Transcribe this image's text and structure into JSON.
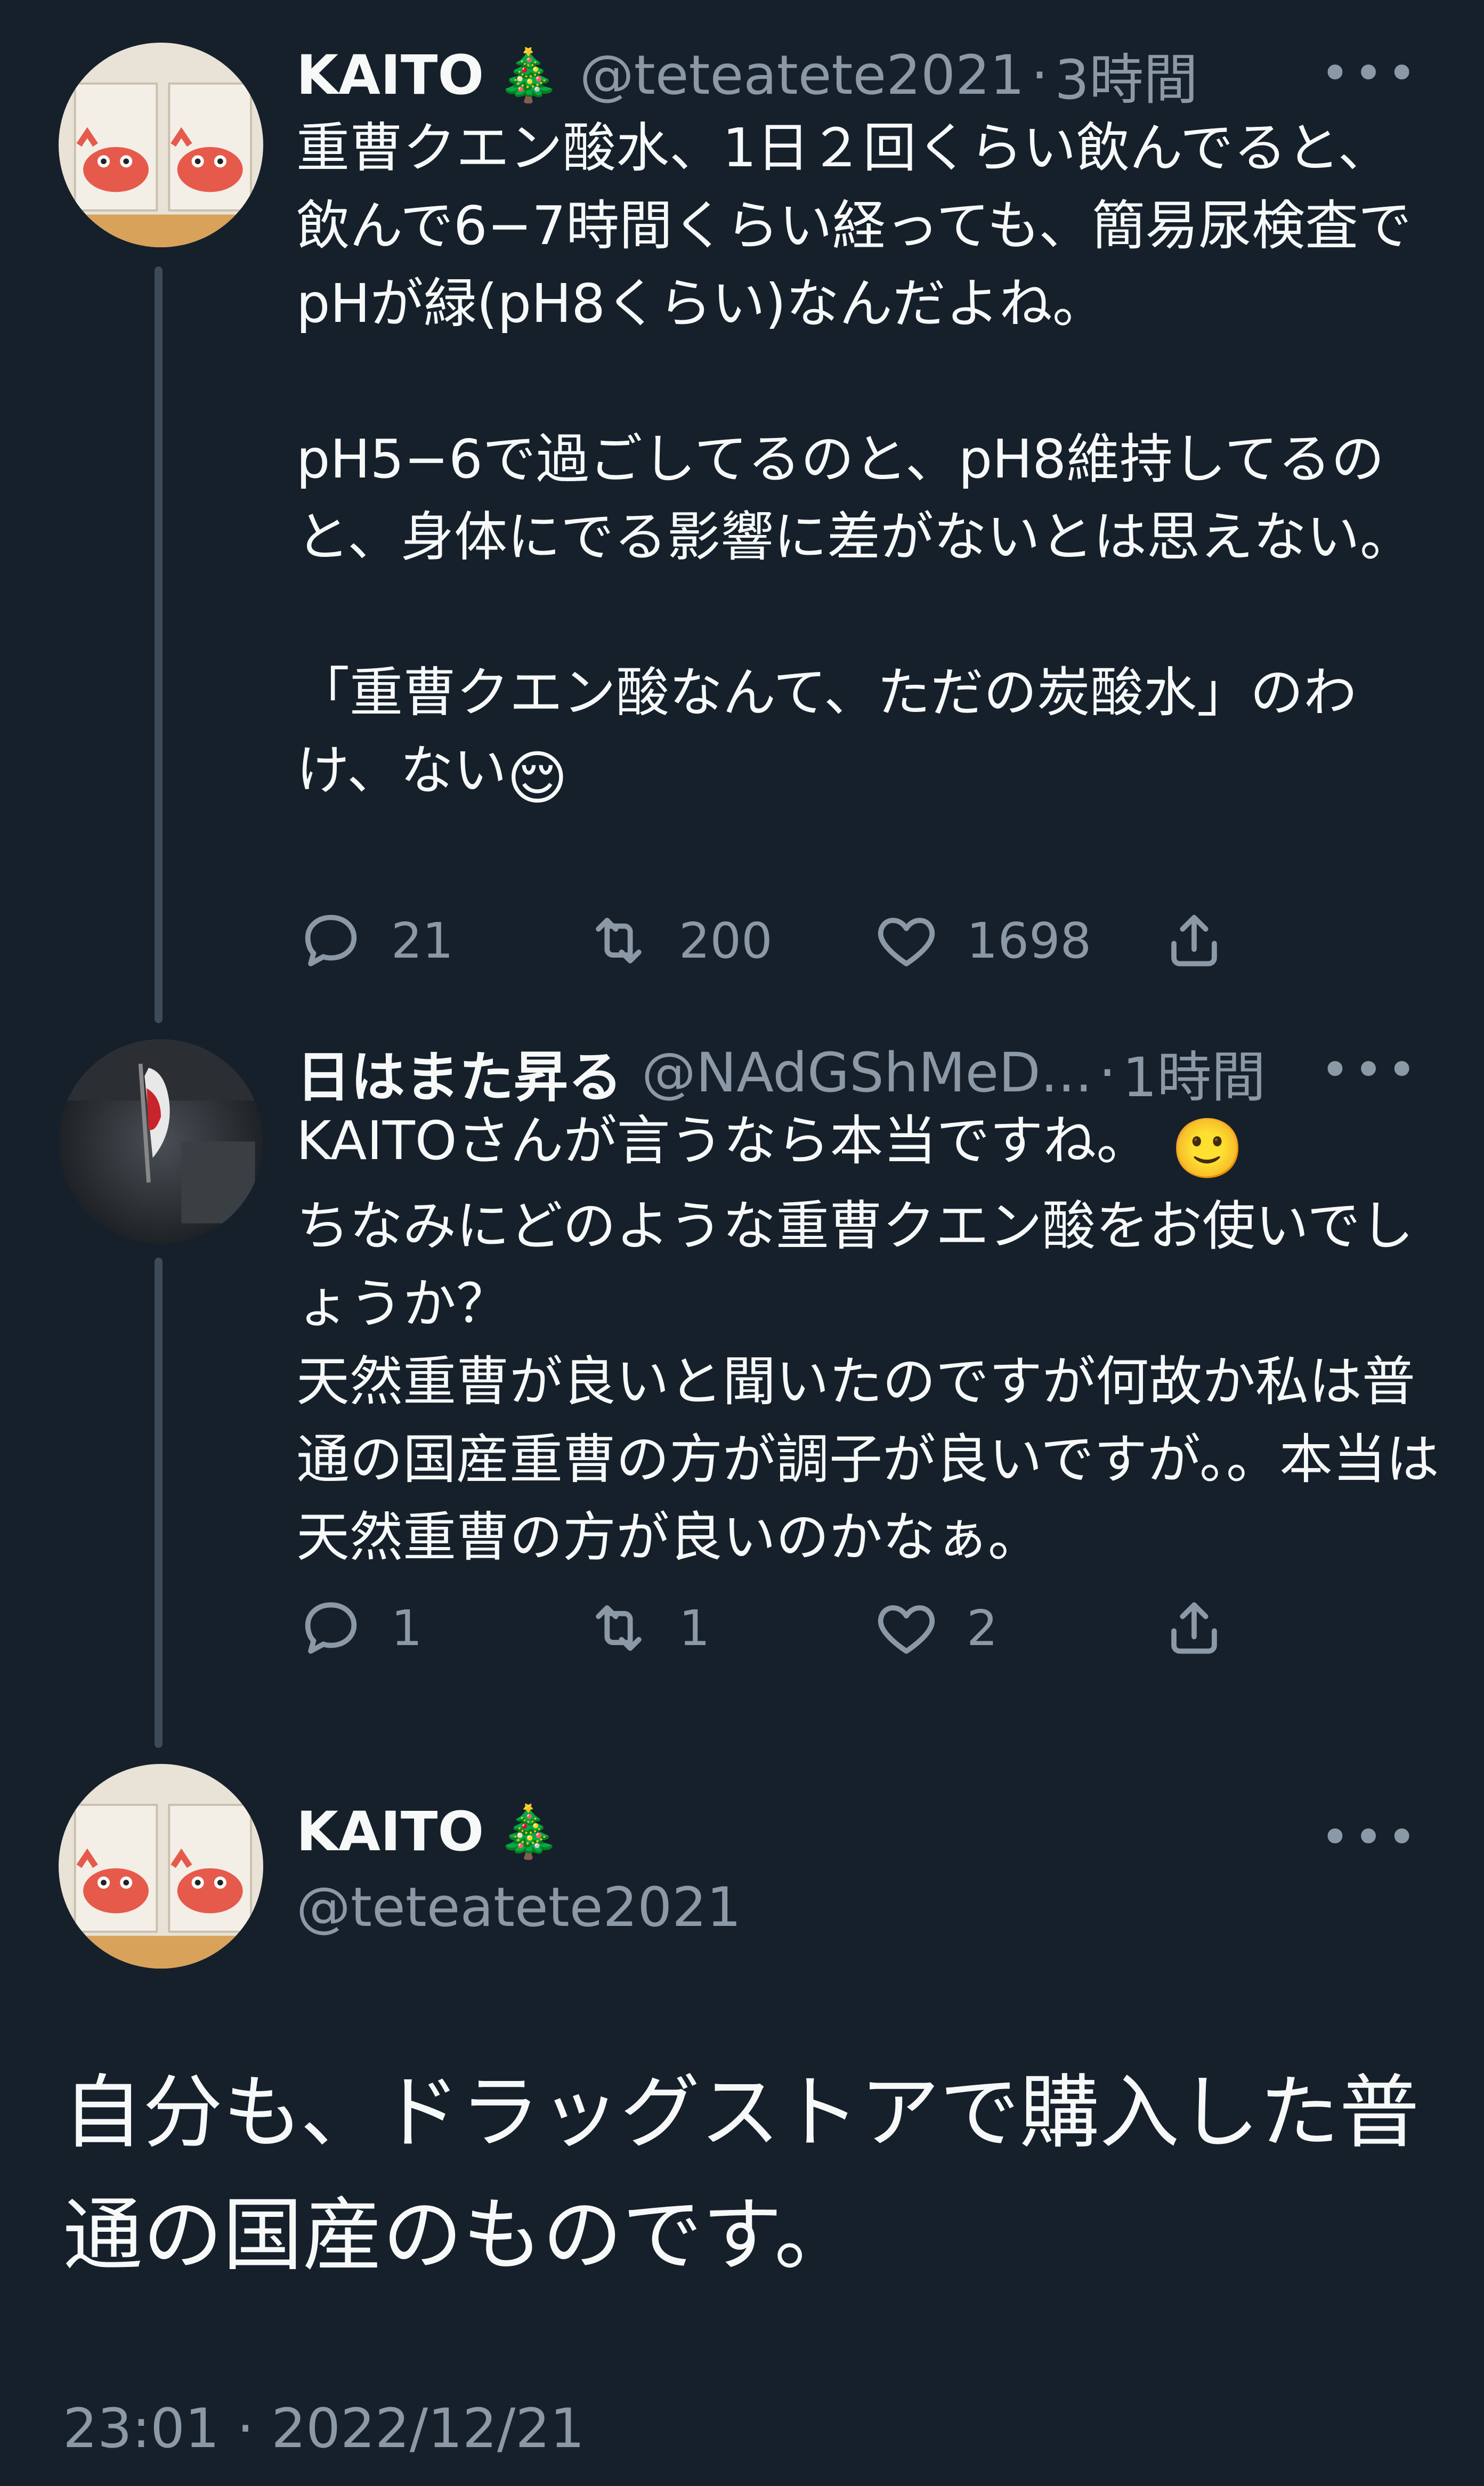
{
  "tweets": [
    {
      "name": "KAITO",
      "name_emoji": "🎄",
      "handle": "@teteatete2021",
      "separator": "·",
      "time": "3時間",
      "text": "重曹クエン酸水、1日２回くらい飲んでると、飲んで6−7時間くらい経っても、簡易尿検査でpHが緑(pH8くらい)なんだよね。\n\npH5−6で過ごしてるのと、pH8維持してるのと、身体にでる影響に差がないとは思えない。\n\n「重曹クエン酸なんて、ただの炭酸水」のわけ、ない",
      "text_emoji": "😌",
      "replies": "21",
      "retweets": "200",
      "likes": "1698"
    },
    {
      "name": "日はまた昇る",
      "handle": "@NAdGShMeD...",
      "separator": "·",
      "time": "1時間",
      "text": "KAITOさんが言うなら本当ですね。",
      "text_emoji": "🙂",
      "text2": "ちなみにどのような重曹クエン酸をお使いでしょうか？\n天然重曹が良いと聞いたのですが何故か私は普通の国産重曹の方が調子が良いですが。。本当は天然重曹の方が良いのかなぁ。",
      "replies": "1",
      "retweets": "1",
      "likes": "2"
    }
  ],
  "main_tweet": {
    "name": "KAITO",
    "name_emoji": "🎄",
    "handle": "@teteatete2021",
    "text": "自分も、ドラッグストアで購入した普通の国産のものです。",
    "timestamp": "23:01 · 2022/12/21"
  },
  "icons": {
    "more": "more-horizontal-icon",
    "reply": "reply-icon",
    "retweet": "retweet-icon",
    "like": "heart-icon",
    "share": "share-icon"
  },
  "colors": {
    "background": "#15202b",
    "text": "#f7f9f9",
    "secondary": "#8b98a5",
    "thread_line": "#3d4a57"
  }
}
